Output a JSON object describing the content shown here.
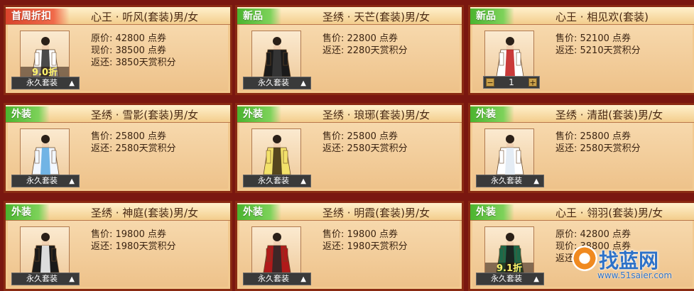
{
  "cards": [
    {
      "tag": "首周折扣",
      "tag_color": "red",
      "name": "心王 · 听风(套装)男/女",
      "lines": [
        "原价: 42800 点券",
        "现价: 38500 点券",
        "返还: 3850天赏积分"
      ],
      "discount": "9.0折",
      "control": "permanent",
      "control_label": "永久套装",
      "figure_colors": [
        "#ffffff",
        "#2a2a2a"
      ]
    },
    {
      "tag": "新品",
      "tag_color": "green",
      "name": "圣绣 · 天芒(套装)男/女",
      "lines": [
        "售价: 22800 点券",
        "返还: 2280天赏积分"
      ],
      "discount": "",
      "control": "permanent",
      "control_label": "永久套装",
      "figure_colors": [
        "#1a1a1a",
        "#3a3a3a"
      ]
    },
    {
      "tag": "新品",
      "tag_color": "green",
      "name": "心王 · 相见欢(套装)",
      "lines": [
        "售价: 52100 点券",
        "返还: 5210天赏积分"
      ],
      "discount": "",
      "control": "quantity",
      "quantity": "1",
      "figure_colors": [
        "#ffffff",
        "#c01818"
      ]
    },
    {
      "tag": "外装",
      "tag_color": "green",
      "name": "圣绣 · 雪影(套装)男/女",
      "lines": [
        "售价: 25800 点券",
        "返还: 2580天赏积分"
      ],
      "discount": "",
      "control": "permanent",
      "control_label": "永久套装",
      "figure_colors": [
        "#f2f7ff",
        "#5aa8e0"
      ]
    },
    {
      "tag": "外装",
      "tag_color": "green",
      "name": "圣绣 · 琅琊(套装)男/女",
      "lines": [
        "售价: 25800 点券",
        "返还: 2580天赏积分"
      ],
      "discount": "",
      "control": "permanent",
      "control_label": "永久套装",
      "figure_colors": [
        "#f3e26a",
        "#3a2a10"
      ]
    },
    {
      "tag": "外装",
      "tag_color": "green",
      "name": "圣绣 · 清甜(套装)男/女",
      "lines": [
        "售价: 25800 点券",
        "返还: 2580天赏积分"
      ],
      "discount": "",
      "control": "permanent",
      "control_label": "永久套装",
      "figure_colors": [
        "#ffffff",
        "#dfe9f2"
      ]
    },
    {
      "tag": "外装",
      "tag_color": "green",
      "name": "圣绣 · 神庭(套装)男/女",
      "lines": [
        "售价: 19800 点券",
        "返还: 1980天赏积分"
      ],
      "discount": "",
      "control": "permanent",
      "control_label": "永久套装",
      "figure_colors": [
        "#1a1a1a",
        "#ffffff"
      ]
    },
    {
      "tag": "外装",
      "tag_color": "green",
      "name": "圣绣 · 明霞(套装)男/女",
      "lines": [
        "售价: 19800 点券",
        "返还: 1980天赏积分"
      ],
      "discount": "",
      "control": "permanent",
      "control_label": "永久套装",
      "figure_colors": [
        "#b01a1a",
        "#2a2a2a"
      ]
    },
    {
      "tag": "外装",
      "tag_color": "green",
      "name": "心王 · 翎羽(套装)男/女",
      "lines": [
        "原价: 42800 点券",
        "现价: 38800 点券",
        "返还: 38"
      ],
      "discount": "9.1折",
      "control": "permanent",
      "control_label": "永久套装",
      "figure_colors": [
        "#1c6a4a",
        "#1a1a1a"
      ]
    }
  ],
  "watermark": {
    "title": "找蓝网",
    "url": "www.51saier.com"
  }
}
